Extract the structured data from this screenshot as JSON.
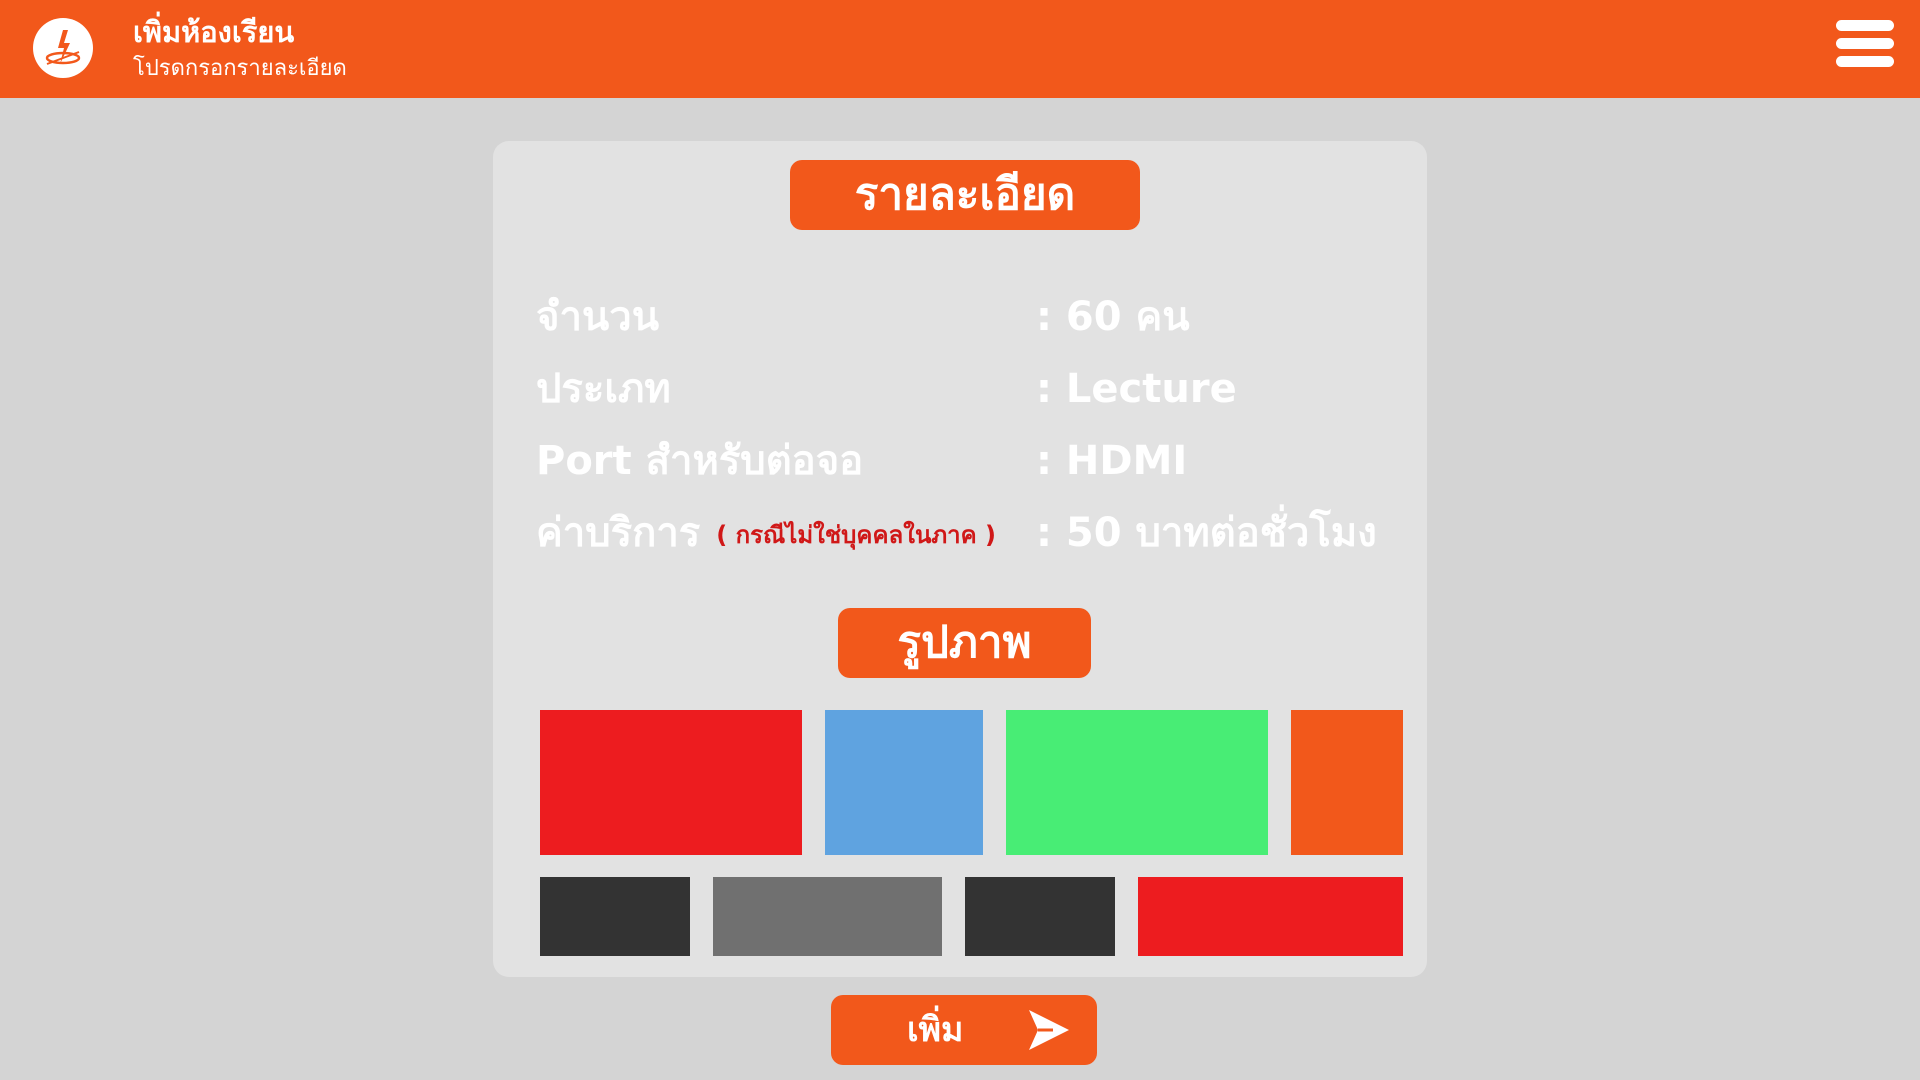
{
  "header": {
    "title": "เพิ่มห้องเรียน",
    "subtitle": "โปรดกรอกรายละเอียด",
    "logo_icon": "lightning-logo-icon",
    "menu_icon": "hamburger-menu-icon"
  },
  "details": {
    "heading": "รายละเอียด",
    "rows": [
      {
        "label": "จำนวน",
        "value": ": 60 คน"
      },
      {
        "label": "ประเภท",
        "value": ": Lecture"
      },
      {
        "label": "Port สำหรับต่อจอ",
        "value": ": HDMI"
      },
      {
        "label": "ค่าบริการ",
        "note": "( กรณีไม่ใช่บุคคลในภาค )",
        "value": ": 50 บาทต่อชั่วโมง"
      }
    ]
  },
  "images": {
    "heading": "รูปภาพ",
    "tiles": [
      {
        "color": "#ed1c1f"
      },
      {
        "color": "#5fa3e0"
      },
      {
        "color": "#48ed75"
      },
      {
        "color": "#f2581b"
      },
      {
        "color": "#333333"
      },
      {
        "color": "#707070"
      },
      {
        "color": "#333333"
      },
      {
        "color": "#ed1c1f"
      }
    ]
  },
  "actions": {
    "add_label": "เพิ่ม",
    "add_icon": "send-arrow-icon"
  },
  "colors": {
    "accent": "#f2581b",
    "background": "#d4d4d4",
    "card": "#e2e2e2",
    "note": "#d01818"
  }
}
